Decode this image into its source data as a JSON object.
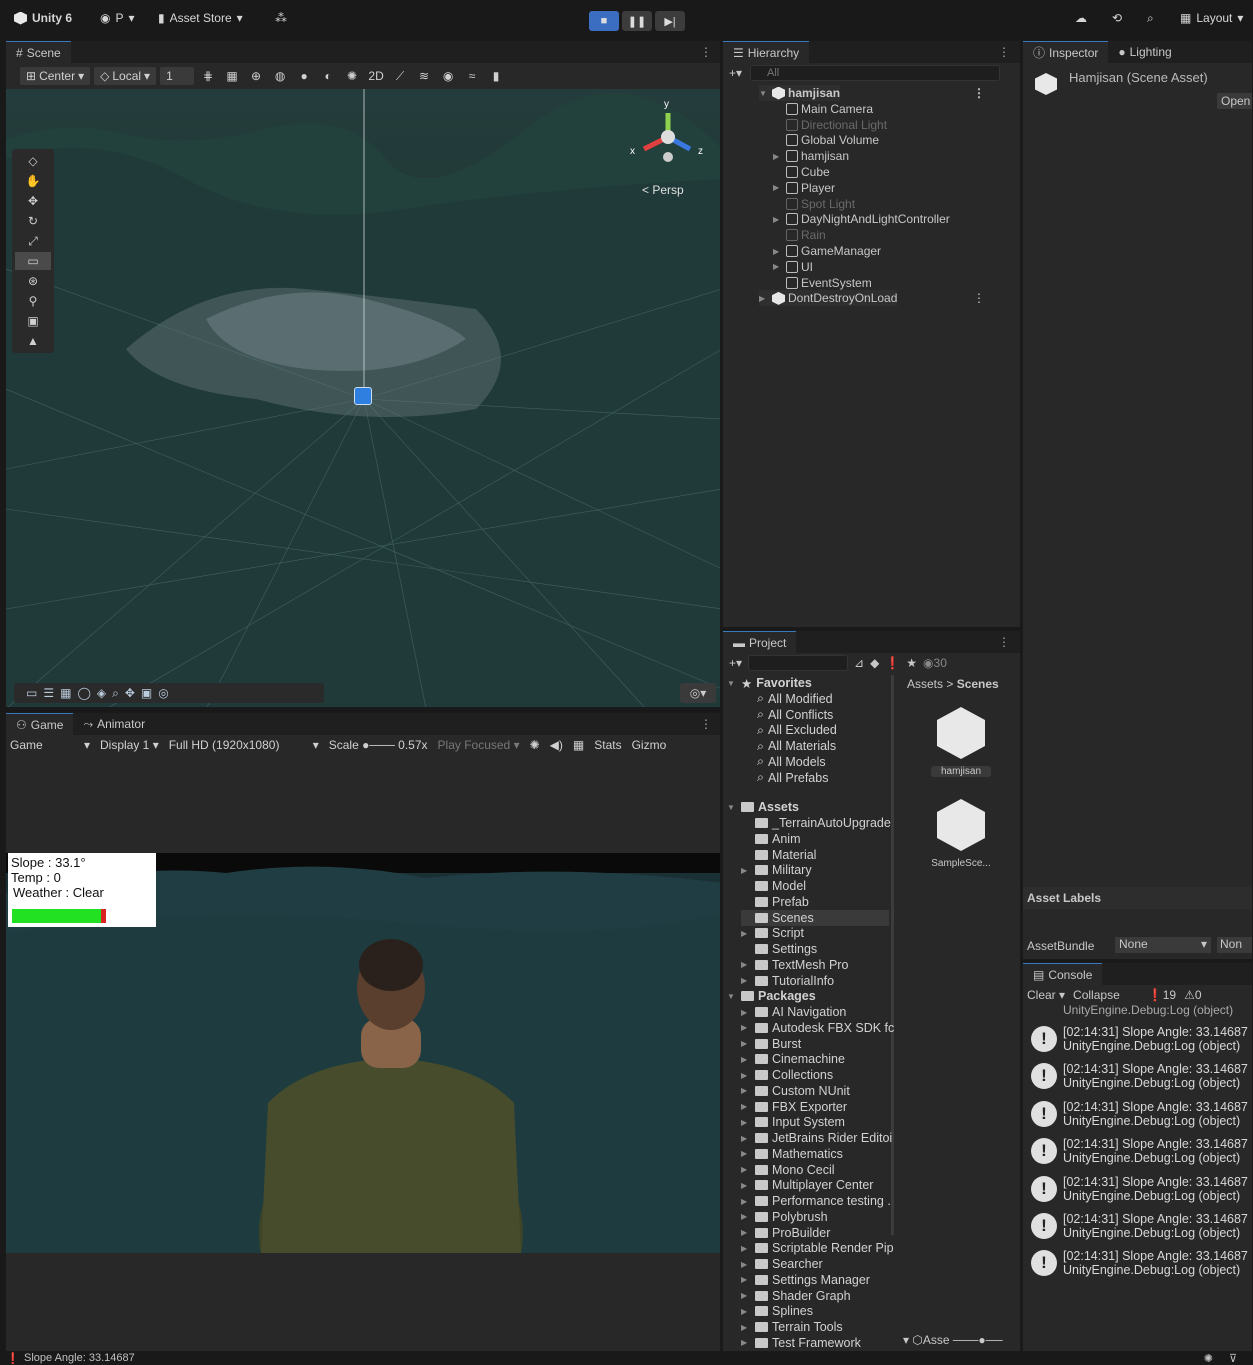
{
  "topbar": {
    "app_title": "Unity 6",
    "account": "P",
    "asset_store": "Asset Store",
    "layout": "Layout"
  },
  "scene": {
    "tab": "Scene",
    "pivot": "Center",
    "space": "Local",
    "snap_value": "1",
    "view_mode": "Persp"
  },
  "game": {
    "tab": "Game",
    "tab2": "Animator",
    "game_select": "Game",
    "display": "Display 1",
    "resolution": "Full HD (1920x1080)",
    "scale_label": "Scale",
    "scale_value": "0.57x",
    "play_focused": "Play Focused",
    "stats": "Stats",
    "gizmos": "Gizmo",
    "hud": {
      "slope": "Slope : 33.1°",
      "temp": "Temp : 0",
      "weather": "Weather : Clear",
      "health_fraction": 0.95
    }
  },
  "hierarchy": {
    "tab": "Hierarchy",
    "search_placeholder": "All",
    "items": [
      {
        "label": "hamjisan",
        "depth": 0,
        "bold": true,
        "dim": false,
        "arrow": "▼"
      },
      {
        "label": "Main Camera",
        "depth": 1,
        "dim": false,
        "arrow": ""
      },
      {
        "label": "Directional Light",
        "depth": 1,
        "dim": true,
        "arrow": ""
      },
      {
        "label": "Global Volume",
        "depth": 1,
        "dim": false,
        "arrow": ""
      },
      {
        "label": "hamjisan",
        "depth": 1,
        "dim": false,
        "arrow": "▶"
      },
      {
        "label": "Cube",
        "depth": 1,
        "dim": false,
        "arrow": ""
      },
      {
        "label": "Player",
        "depth": 1,
        "dim": false,
        "arrow": "▶"
      },
      {
        "label": "Spot Light",
        "depth": 1,
        "dim": true,
        "arrow": ""
      },
      {
        "label": "DayNightAndLightController",
        "depth": 1,
        "dim": false,
        "arrow": "▶"
      },
      {
        "label": "Rain",
        "depth": 1,
        "dim": true,
        "arrow": ""
      },
      {
        "label": "GameManager",
        "depth": 1,
        "dim": false,
        "arrow": "▶"
      },
      {
        "label": "UI",
        "depth": 1,
        "dim": false,
        "arrow": "▶"
      },
      {
        "label": "EventSystem",
        "depth": 1,
        "dim": false,
        "arrow": ""
      },
      {
        "label": "DontDestroyOnLoad",
        "depth": 0,
        "dim": false,
        "arrow": "▶"
      }
    ]
  },
  "inspector": {
    "tab": "Inspector",
    "tab2": "Lighting",
    "title": "Hamjisan (Scene Asset)",
    "open_button": "Open",
    "asset_labels": "Asset Labels",
    "assetbundle_label": "AssetBundle",
    "assetbundle_value": "None",
    "variant_value": "Non"
  },
  "console": {
    "tab": "Console",
    "clear": "Clear",
    "collapse": "Collapse",
    "count_logs": "19",
    "count_warnings": "0",
    "partial_line": "UnityEngine.Debug:Log (object)",
    "entries": [
      {
        "line1": "[02:14:31] Slope Angle: 33.14687",
        "line2": "UnityEngine.Debug:Log (object)"
      },
      {
        "line1": "[02:14:31] Slope Angle: 33.14687",
        "line2": "UnityEngine.Debug:Log (object)"
      },
      {
        "line1": "[02:14:31] Slope Angle: 33.14687",
        "line2": "UnityEngine.Debug:Log (object)"
      },
      {
        "line1": "[02:14:31] Slope Angle: 33.14687",
        "line2": "UnityEngine.Debug:Log (object)"
      },
      {
        "line1": "[02:14:31] Slope Angle: 33.14687",
        "line2": "UnityEngine.Debug:Log (object)"
      },
      {
        "line1": "[02:14:31] Slope Angle: 33.14687",
        "line2": "UnityEngine.Debug:Log (object)"
      },
      {
        "line1": "[02:14:31] Slope Angle: 33.14687",
        "line2": "UnityEngine.Debug:Log (object)"
      }
    ]
  },
  "project": {
    "tab": "Project",
    "visible_count": "30",
    "breadcrumb_root": "Assets",
    "breadcrumb_current": "Scenes",
    "favorites_label": "Favorites",
    "favorites": [
      "All Modified",
      "All Conflicts",
      "All Excluded",
      "All Materials",
      "All Models",
      "All Prefabs"
    ],
    "assets_label": "Assets",
    "assets": [
      {
        "label": "_TerrainAutoUpgrade",
        "arrow": false
      },
      {
        "label": "Anim",
        "arrow": false
      },
      {
        "label": "Material",
        "arrow": false
      },
      {
        "label": "Military",
        "arrow": true
      },
      {
        "label": "Model",
        "arrow": false
      },
      {
        "label": "Prefab",
        "arrow": false
      },
      {
        "label": "Scenes",
        "arrow": false,
        "selected": true
      },
      {
        "label": "Script",
        "arrow": true
      },
      {
        "label": "Settings",
        "arrow": false
      },
      {
        "label": "TextMesh Pro",
        "arrow": true
      },
      {
        "label": "TutorialInfo",
        "arrow": true
      }
    ],
    "packages_label": "Packages",
    "packages": [
      "AI Navigation",
      "Autodesk FBX SDK fc",
      "Burst",
      "Cinemachine",
      "Collections",
      "Custom NUnit",
      "FBX Exporter",
      "Input System",
      "JetBrains Rider Editoi",
      "Mathematics",
      "Mono Cecil",
      "Multiplayer Center",
      "Performance testing .",
      "Polybrush",
      "ProBuilder",
      "Scriptable Render Pip",
      "Searcher",
      "Settings Manager",
      "Shader Graph",
      "Splines",
      "Terrain Tools",
      "Test Framework"
    ],
    "grid_items": [
      "hamjisan",
      "SampleSce..."
    ],
    "footer_label": "Asse"
  },
  "status": {
    "message": "Slope Angle: 33.14687"
  }
}
